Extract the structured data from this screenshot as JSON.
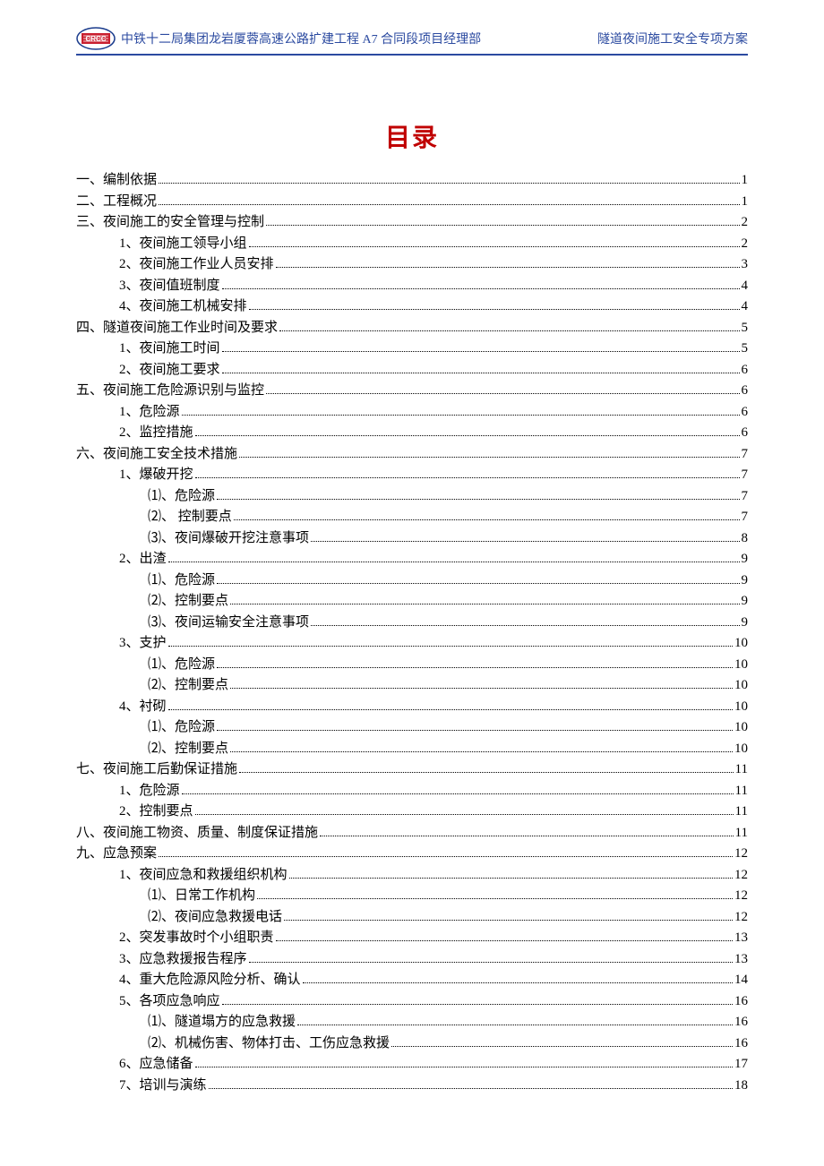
{
  "header": {
    "left": "中铁十二局集团龙岩厦蓉高速公路扩建工程 A7 合同段项目经理部",
    "right": "隧道夜间施工安全专项方案"
  },
  "title": "目录",
  "toc": [
    {
      "lvl": 1,
      "text": "一、编制依据",
      "page": "1"
    },
    {
      "lvl": 1,
      "text": "二、工程概况",
      "page": "1"
    },
    {
      "lvl": 1,
      "text": "三、夜间施工的安全管理与控制",
      "page": "2"
    },
    {
      "lvl": 2,
      "text": "1、夜间施工领导小组",
      "page": "2"
    },
    {
      "lvl": 2,
      "text": "2、夜间施工作业人员安排",
      "page": "3"
    },
    {
      "lvl": 2,
      "text": "3、夜间值班制度",
      "page": "4"
    },
    {
      "lvl": 2,
      "text": "4、夜间施工机械安排",
      "page": "4"
    },
    {
      "lvl": 1,
      "text": "四、隧道夜间施工作业时间及要求",
      "page": "5"
    },
    {
      "lvl": 2,
      "text": "1、夜间施工时间",
      "page": "5"
    },
    {
      "lvl": 2,
      "text": "2、夜间施工要求",
      "page": "6"
    },
    {
      "lvl": 1,
      "text": "五、夜间施工危险源识别与监控",
      "page": "6"
    },
    {
      "lvl": 2,
      "text": "1、危险源",
      "page": "6"
    },
    {
      "lvl": 2,
      "text": "2、监控措施",
      "page": "6"
    },
    {
      "lvl": 1,
      "text": "六、夜间施工安全技术措施",
      "page": "7"
    },
    {
      "lvl": 2,
      "text": "1、爆破开挖",
      "page": "7"
    },
    {
      "lvl": 3,
      "text": "⑴、危险源",
      "page": "7"
    },
    {
      "lvl": 3,
      "text": "⑵、 控制要点",
      "page": "7"
    },
    {
      "lvl": 3,
      "text": "⑶、夜间爆破开挖注意事项",
      "page": "8"
    },
    {
      "lvl": 2,
      "text": "2、出渣",
      "page": "9"
    },
    {
      "lvl": 3,
      "text": "⑴、危险源",
      "page": "9"
    },
    {
      "lvl": 3,
      "text": "⑵、控制要点",
      "page": "9"
    },
    {
      "lvl": 3,
      "text": "⑶、夜间运输安全注意事项",
      "page": "9"
    },
    {
      "lvl": 2,
      "text": "3、支护",
      "page": "10"
    },
    {
      "lvl": 3,
      "text": "⑴、危险源",
      "page": "10"
    },
    {
      "lvl": 3,
      "text": "⑵、控制要点",
      "page": "10"
    },
    {
      "lvl": 2,
      "text": "4、衬砌",
      "page": "10"
    },
    {
      "lvl": 3,
      "text": "⑴、危险源",
      "page": "10"
    },
    {
      "lvl": 3,
      "text": "⑵、控制要点",
      "page": "10"
    },
    {
      "lvl": 1,
      "text": "七、夜间施工后勤保证措施",
      "page": "11"
    },
    {
      "lvl": 2,
      "text": "1、危险源",
      "page": "11"
    },
    {
      "lvl": 2,
      "text": "2、控制要点",
      "page": "11"
    },
    {
      "lvl": 1,
      "text": "八、夜间施工物资、质量、制度保证措施",
      "page": "11"
    },
    {
      "lvl": 1,
      "text": "九、应急预案",
      "page": "12"
    },
    {
      "lvl": 2,
      "text": "1、夜间应急和救援组织机构",
      "page": "12"
    },
    {
      "lvl": 3,
      "text": "⑴、日常工作机构",
      "page": "12"
    },
    {
      "lvl": 3,
      "text": "⑵、夜间应急救援电话",
      "page": "12"
    },
    {
      "lvl": 2,
      "text": "2、突发事故时个小组职责",
      "page": "13"
    },
    {
      "lvl": 2,
      "text": "3、应急救援报告程序",
      "page": "13"
    },
    {
      "lvl": 2,
      "text": "4、重大危险源风险分析、确认",
      "page": "14"
    },
    {
      "lvl": 2,
      "text": "5、各项应急响应",
      "page": "16"
    },
    {
      "lvl": 3,
      "text": "⑴、隧道塌方的应急救援",
      "page": "16"
    },
    {
      "lvl": 3,
      "text": "⑵、机械伤害、物体打击、工伤应急救援",
      "page": "16"
    },
    {
      "lvl": 2,
      "text": "6、应急储备",
      "page": "17"
    },
    {
      "lvl": 2,
      "text": "7、培训与演练",
      "page": "18"
    }
  ]
}
